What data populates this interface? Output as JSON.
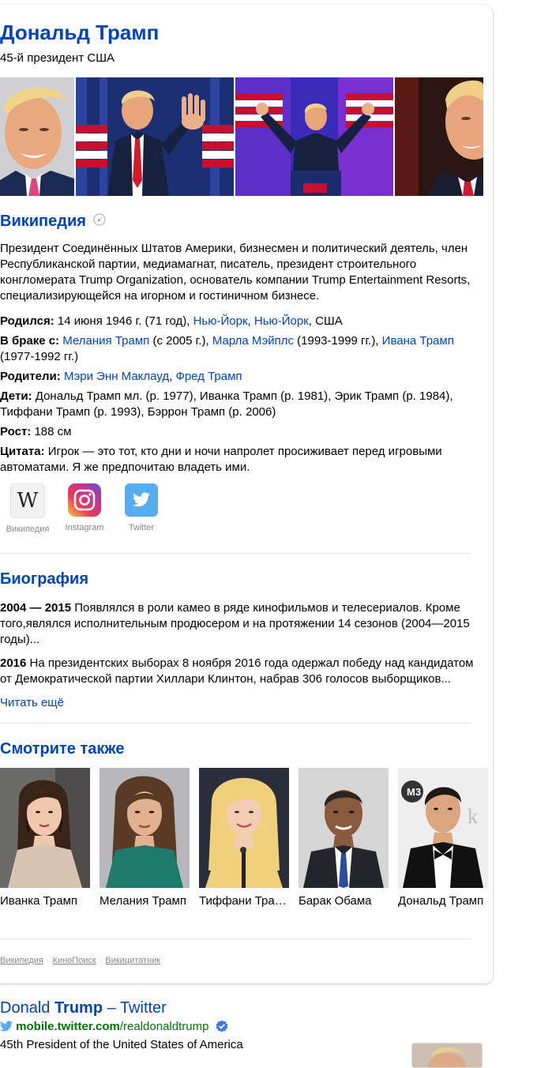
{
  "entity": {
    "title": "Дональд Трамп",
    "subtitle": "45-й президент США"
  },
  "wiki": {
    "heading": "Википедия",
    "description": "Президент Соединённых Штатов Америки, бизнесмен и политический деятель, член Республиканской партии, медиамагнат, писатель, президент строительного конгломерата Trump Organization, основатель компании Trump Entertainment Resorts, специализирующейся на игорном и гостиничном бизнесе."
  },
  "facts": {
    "born": {
      "label": "Родился:",
      "text1": " 14 июня 1946 г. (71 год), ",
      "link1": "Нью-Йорк",
      "sep": ", ",
      "link2": "Нью-Йорк",
      "text2": ", США"
    },
    "spouse": {
      "label": "В браке с:",
      "link1": "Мелания Трамп",
      "text1": " (с 2005 г.), ",
      "link2": "Марла Мэйплс",
      "text2": " (1993-1999 гг.), ",
      "link3": "Ивана Трамп",
      "text3": " (1977-1992 гг.)"
    },
    "parents": {
      "label": "Родители:",
      "link1": "Мэри Энн Маклауд",
      "sep": ", ",
      "link2": "Фред Трамп"
    },
    "children": {
      "label": "Дети:",
      "text": " Дональд Трамп мл. (р. 1977), Иванка Трамп (р. 1981), Эрик Трамп (р. 1984), Тиффани Трамп (р. 1993), Бэррон Трамп (р. 2006)"
    },
    "height": {
      "label": "Рост:",
      "text": " 188 см"
    },
    "quote": {
      "label": "Цитата:",
      "text": " Игрок — это тот, кто дни и ночи напролет просиживает перед игровыми автоматами. Я же предпочитаю владеть ими."
    }
  },
  "social": [
    {
      "label": "Википедия",
      "icon": "wikipedia-icon",
      "glyph": "W"
    },
    {
      "label": "Instagram",
      "icon": "instagram-icon"
    },
    {
      "label": "Twitter",
      "icon": "twitter-icon"
    }
  ],
  "biography": {
    "heading": "Биография",
    "items": [
      {
        "year": "2004 — 2015",
        "text": " Появлялся в роли камео в ряде кинофильмов и телесериалов. Кроме того,являлся исполнительным продюсером и на протяжении 14 сезонов (2004—2015 годы)..."
      },
      {
        "year": "2016",
        "text": " На президентских выборах 8 ноября 2016 года одержал победу над кандидатом от Демократической партии Хиллари Клинтон, набрав 306 голосов выборщиков..."
      }
    ],
    "read_more": "Читать ещё"
  },
  "see_also": {
    "heading": "Смотрите также",
    "people": [
      {
        "name": "Иванка Трамп"
      },
      {
        "name": "Мелания Трамп"
      },
      {
        "name": "Тиффани Трамп"
      },
      {
        "name": "Барак Обама"
      },
      {
        "name": "Дональд Трамп"
      }
    ]
  },
  "sources": [
    "Википедия",
    "КиноПоиск",
    "Викицитатник"
  ],
  "result": {
    "title_pre": "Donald ",
    "title_bold": "Trump",
    "title_post": " – Twitter",
    "domain": "mobile.twitter.com",
    "path": "/realdonaldtrump",
    "description": "45th President of the United States of America"
  },
  "colors": {
    "link": "#0044bb",
    "url_green": "#007700",
    "muted": "#888888",
    "twitter_blue": "#55acee",
    "verified_blue": "#3d7ce6"
  }
}
